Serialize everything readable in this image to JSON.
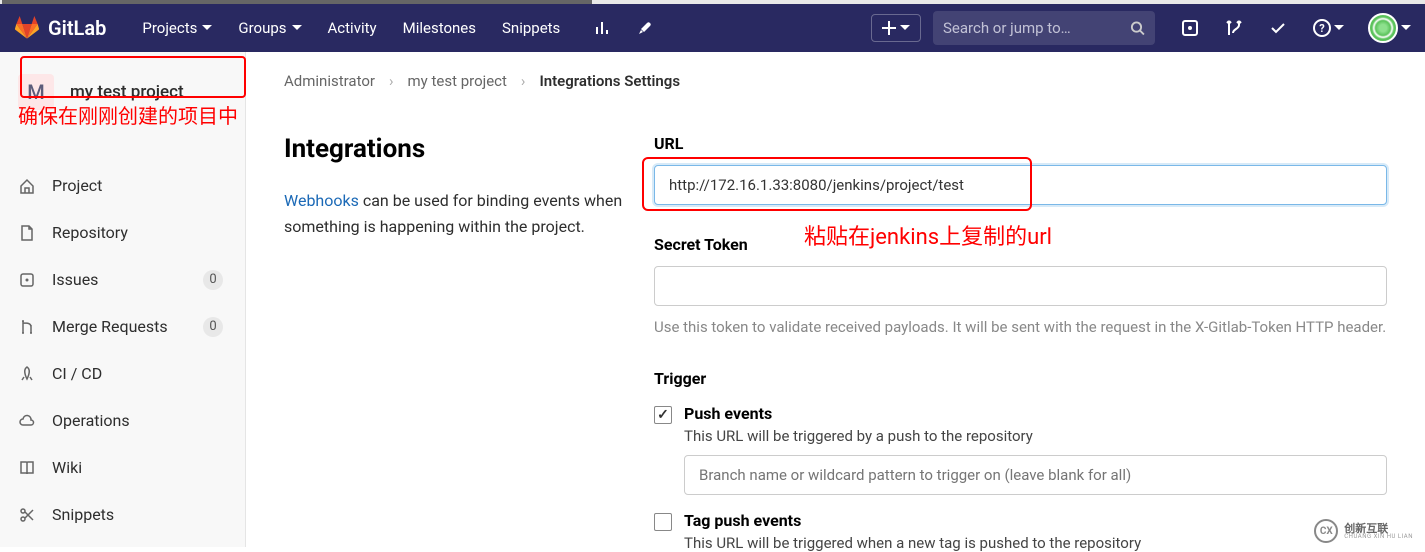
{
  "navbar": {
    "app_name": "GitLab",
    "links": [
      {
        "label": "Projects",
        "dropdown": true
      },
      {
        "label": "Groups",
        "dropdown": true
      },
      {
        "label": "Activity",
        "dropdown": false
      },
      {
        "label": "Milestones",
        "dropdown": false
      },
      {
        "label": "Snippets",
        "dropdown": false
      }
    ],
    "search_placeholder": "Search or jump to…"
  },
  "sidebar": {
    "project_initial": "M",
    "project_name": "my test project",
    "items": [
      {
        "icon": "home",
        "label": "Project"
      },
      {
        "icon": "file",
        "label": "Repository"
      },
      {
        "icon": "issues",
        "label": "Issues",
        "count": "0"
      },
      {
        "icon": "merge",
        "label": "Merge Requests",
        "count": "0"
      },
      {
        "icon": "ci",
        "label": "CI / CD"
      },
      {
        "icon": "cloud",
        "label": "Operations"
      },
      {
        "icon": "book",
        "label": "Wiki"
      },
      {
        "icon": "snippets",
        "label": "Snippets"
      }
    ]
  },
  "breadcrumb": {
    "items": [
      "Administrator",
      "my test project"
    ],
    "current": "Integrations Settings"
  },
  "integrations": {
    "title": "Integrations",
    "link_text": "Webhooks",
    "description_after": " can be used for binding events when something is happening within the project."
  },
  "form": {
    "url_label": "URL",
    "url_value": "http://172.16.1.33:8080/jenkins/project/test",
    "secret_label": "Secret Token",
    "secret_value": "",
    "secret_helper": "Use this token to validate received payloads. It will be sent with the request in the X-Gitlab-Token HTTP header.",
    "trigger_label": "Trigger",
    "triggers": [
      {
        "checked": true,
        "title": "Push events",
        "desc": "This URL will be triggered by a push to the repository",
        "input_placeholder": "Branch name or wildcard pattern to trigger on (leave blank for all)"
      },
      {
        "checked": false,
        "title": "Tag push events",
        "desc": "This URL will be triggered when a new tag is pushed to the repository"
      }
    ]
  },
  "annotations": {
    "project": "确保在刚刚创建的项目中",
    "url": "粘贴在jenkins上复制的url"
  },
  "watermark": {
    "main": "创新互联",
    "sub": "CHUANG XIN HU LIAN"
  }
}
